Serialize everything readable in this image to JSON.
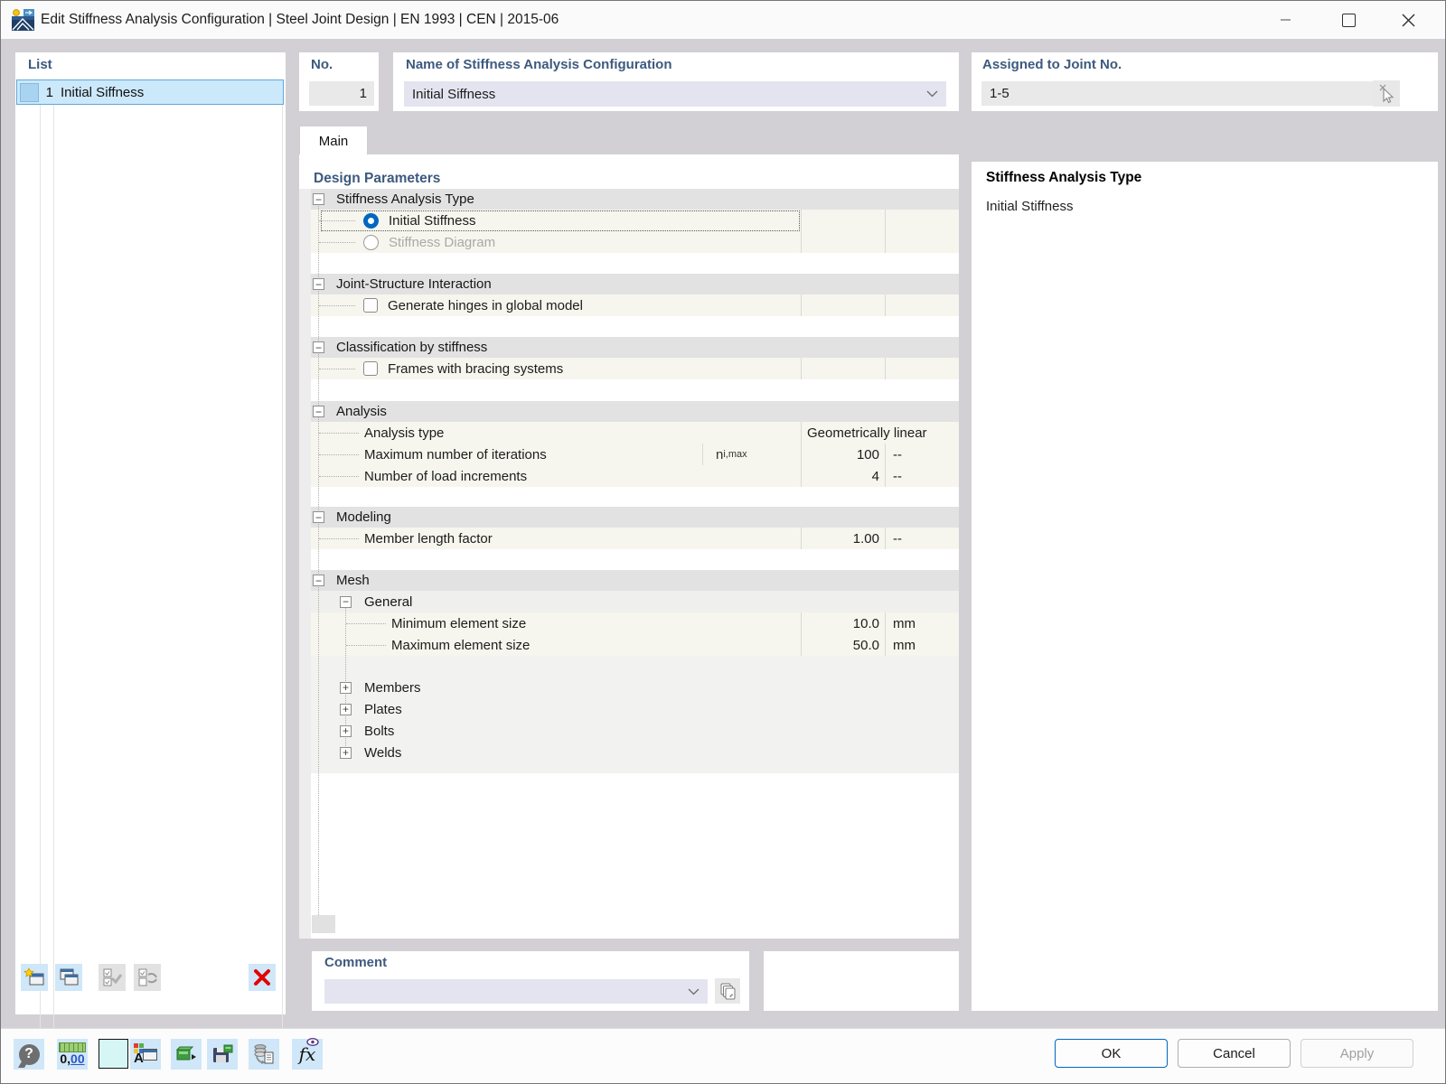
{
  "colors": {
    "accent": "#0067c0",
    "label_blue": "#3d5a7e",
    "selection_bg": "#cce8fb"
  },
  "window": {
    "title": "Edit Stiffness Analysis Configuration | Steel Joint Design | EN 1993 | CEN | 2015-06"
  },
  "list_panel": {
    "label": "List",
    "selected_item": {
      "no": "1",
      "name": "Initial Siffness"
    }
  },
  "header_fields": {
    "no": {
      "label": "No.",
      "value": "1"
    },
    "name": {
      "label": "Name of Stiffness Analysis Configuration",
      "value": "Initial Siffness"
    },
    "assigned": {
      "label": "Assigned to Joint No.",
      "value": "1-5"
    }
  },
  "tab": {
    "label": "Main"
  },
  "grid": {
    "title": "Design Parameters",
    "icons": {
      "minus": "−",
      "plus": "+"
    },
    "sections": {
      "stiffness_type": {
        "title": "Stiffness Analysis Type",
        "options": [
          {
            "label": "Initial Stiffness"
          },
          {
            "label": "Stiffness Diagram"
          }
        ]
      },
      "interaction": {
        "title": "Joint-Structure Interaction",
        "checkbox": "Generate hinges in global model"
      },
      "classification": {
        "title": "Classification by stiffness",
        "checkbox": "Frames with bracing systems"
      },
      "analysis": {
        "title": "Analysis",
        "rows": [
          {
            "label": "Analysis type",
            "value": "Geometrically linear"
          },
          {
            "label": "Maximum number of iterations",
            "symbol_base": "n",
            "symbol_sub": "i,max",
            "value": "100",
            "unit": "--"
          },
          {
            "label": "Number of load increments",
            "value": "4",
            "unit": "--"
          }
        ]
      },
      "modeling": {
        "title": "Modeling",
        "rows": [
          {
            "label": "Member length factor",
            "value": "1.00",
            "unit": "--"
          }
        ]
      },
      "mesh": {
        "title": "Mesh",
        "general": {
          "title": "General",
          "rows": [
            {
              "label": "Minimum element size",
              "value": "10.0",
              "unit": "mm"
            },
            {
              "label": "Maximum element size",
              "value": "50.0",
              "unit": "mm"
            }
          ]
        },
        "collapsed": [
          {
            "label": "Members"
          },
          {
            "label": "Plates"
          },
          {
            "label": "Bolts"
          },
          {
            "label": "Welds"
          }
        ]
      }
    }
  },
  "info_panel": {
    "title": "Stiffness Analysis Type",
    "value": "Initial Stiffness"
  },
  "comment": {
    "label": "Comment",
    "value": ""
  },
  "toolbar": {
    "help": "?",
    "units_zero": "0,",
    "units_decimals": "00",
    "display_letter": "A",
    "formula": "fx"
  },
  "footer": {
    "ok": "OK",
    "cancel": "Cancel",
    "apply": "Apply"
  }
}
